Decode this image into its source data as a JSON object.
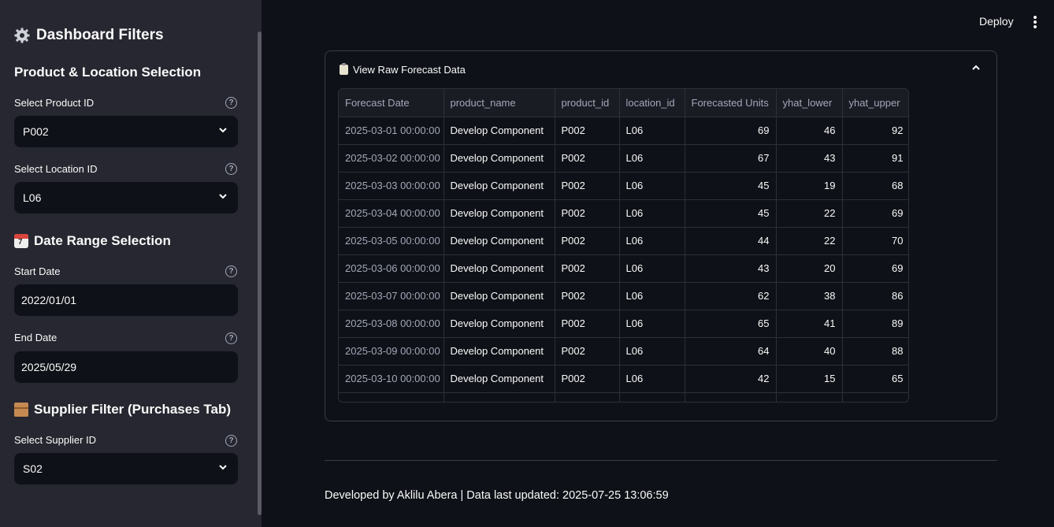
{
  "header": {
    "deploy_label": "Deploy",
    "menu_icon": "kebab-menu-icon"
  },
  "sidebar": {
    "title": "Dashboard Filters",
    "section_product_location": "Product & Location Selection",
    "product_label": "Select Product ID",
    "product_value": "P002",
    "location_label": "Select Location ID",
    "location_value": "L06",
    "section_date": "Date Range Selection",
    "start_label": "Start Date",
    "start_value": "2022/01/01",
    "end_label": "End Date",
    "end_value": "2025/05/29",
    "section_supplier": "Supplier Filter (Purchases Tab)",
    "supplier_label": "Select Supplier ID",
    "supplier_value": "S02",
    "help_glyph": "?"
  },
  "expander": {
    "title": "View Raw Forecast Data",
    "columns": [
      "Forecast Date",
      "product_name",
      "product_id",
      "location_id",
      "Forecasted Units",
      "yhat_lower",
      "yhat_upper"
    ],
    "rows": [
      [
        "2025-03-01 00:00:00",
        "Develop Component",
        "P002",
        "L06",
        "69",
        "46",
        "92"
      ],
      [
        "2025-03-02 00:00:00",
        "Develop Component",
        "P002",
        "L06",
        "67",
        "43",
        "91"
      ],
      [
        "2025-03-03 00:00:00",
        "Develop Component",
        "P002",
        "L06",
        "45",
        "19",
        "68"
      ],
      [
        "2025-03-04 00:00:00",
        "Develop Component",
        "P002",
        "L06",
        "45",
        "22",
        "69"
      ],
      [
        "2025-03-05 00:00:00",
        "Develop Component",
        "P002",
        "L06",
        "44",
        "22",
        "70"
      ],
      [
        "2025-03-06 00:00:00",
        "Develop Component",
        "P002",
        "L06",
        "43",
        "20",
        "69"
      ],
      [
        "2025-03-07 00:00:00",
        "Develop Component",
        "P002",
        "L06",
        "62",
        "38",
        "86"
      ],
      [
        "2025-03-08 00:00:00",
        "Develop Component",
        "P002",
        "L06",
        "65",
        "41",
        "89"
      ],
      [
        "2025-03-09 00:00:00",
        "Develop Component",
        "P002",
        "L06",
        "64",
        "40",
        "88"
      ],
      [
        "2025-03-10 00:00:00",
        "Develop Component",
        "P002",
        "L06",
        "42",
        "15",
        "65"
      ]
    ]
  },
  "footer": {
    "text": "Developed by Aklilu Abera | Data last updated: 2025-07-25 13:06:59"
  },
  "colors": {
    "sidebar_bg": "#262730",
    "main_bg": "#0e1117",
    "text": "#fafafa",
    "muted": "#a3a8b8"
  }
}
